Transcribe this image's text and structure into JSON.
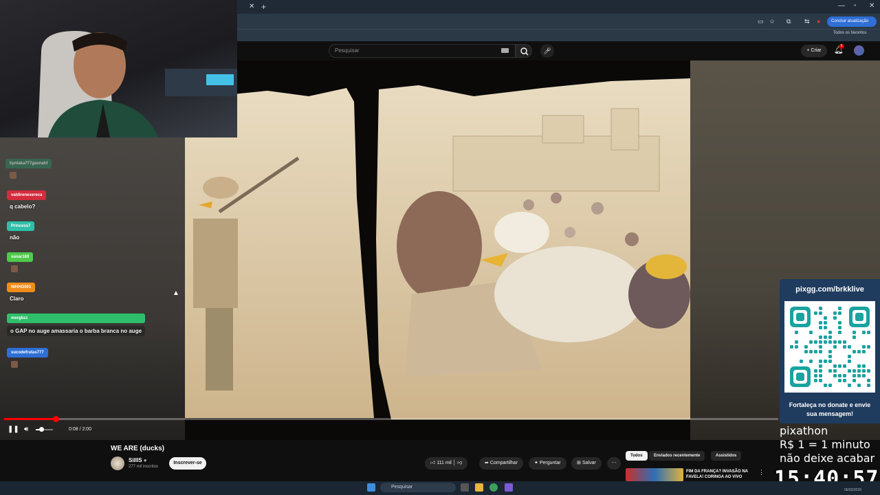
{
  "browser": {
    "update_button": "Concluir atualização",
    "favorites_label": "Todos os favoritos"
  },
  "youtube": {
    "search_placeholder": "Pesquisar",
    "create_label": "Criar",
    "notifications_badge": "9"
  },
  "chat": [
    {
      "user": "kyntaka777gasnahf",
      "message": "",
      "color": "#2e7d5a"
    },
    {
      "user": "valdirenexereca",
      "message": "q cabelo?",
      "color": "#d62b3c"
    },
    {
      "user": "Princess7",
      "message": "não",
      "color": "#2fbfa8"
    },
    {
      "user": "sonar169",
      "message": "",
      "color": "#4fc94a"
    },
    {
      "user": "NIHHO001",
      "message": "Claro",
      "color": "#f08c1c"
    },
    {
      "user": "mergbzz",
      "message": "o GAP no auge amassaria o barba branca no auge",
      "color": "#2fbf6a"
    },
    {
      "user": "sucodefrutas777",
      "message": "",
      "color": "#2d6fd6"
    }
  ],
  "player": {
    "time": "0:08 / 2:00",
    "progress": 0.067
  },
  "video": {
    "title": "WE ARE (ducks)",
    "channel": "SillIS",
    "subscribers": "277 mil inscritos",
    "subscribe_label": "Inscrever-se",
    "likes": "111 mil",
    "share_label": "Compartilhar",
    "ask_label": "Perguntar",
    "save_label": "Salvar"
  },
  "chips": [
    "Todos",
    "Enviados recentemente",
    "Assistidos"
  ],
  "recommendation": {
    "title": "FIM DA FRANÇA? INVASÃO NA FAVELA! CORINGA AO VIVO"
  },
  "donation": {
    "url": "pixgg.com/brkklive",
    "note": "Fortaleça no donate e envie sua mensagem!",
    "pixathon_lines": [
      "pixathon",
      "R$ 1 = 1 minuto",
      "não deixe acabar"
    ],
    "clock": "15:40:57"
  },
  "taskbar": {
    "search_label": "Pesquisar",
    "date": "06/02/2026"
  }
}
